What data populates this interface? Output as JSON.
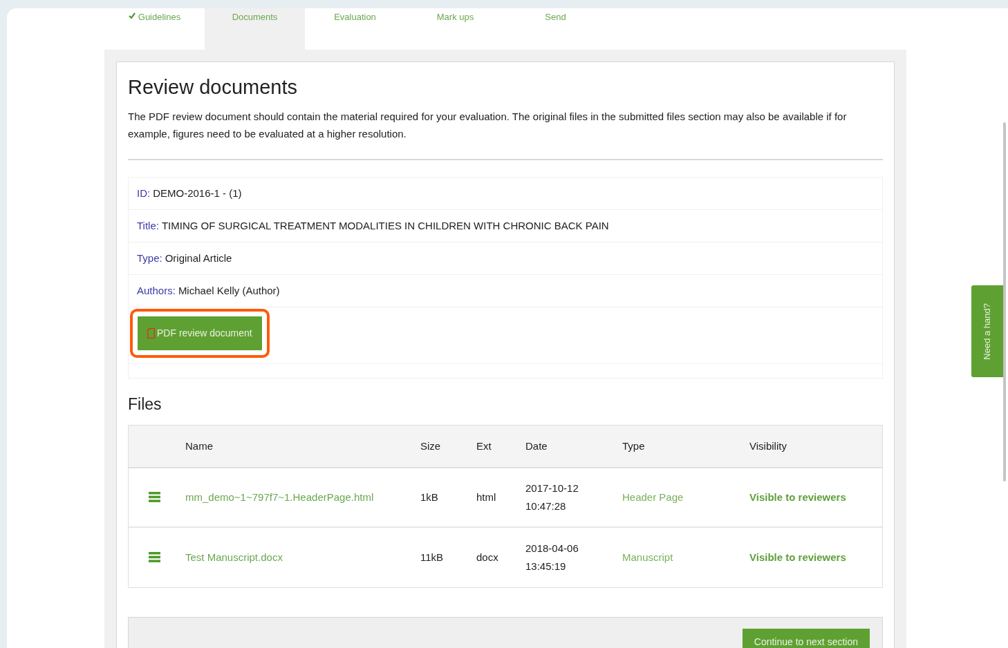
{
  "tabs": [
    {
      "label": "Guidelines",
      "completed": true,
      "selected": false
    },
    {
      "label": "Documents",
      "completed": false,
      "selected": true
    },
    {
      "label": "Evaluation",
      "completed": false,
      "selected": false
    },
    {
      "label": "Mark ups",
      "completed": false,
      "selected": false
    },
    {
      "label": "Send",
      "completed": false,
      "selected": false
    }
  ],
  "heading": "Review documents",
  "intro": "The PDF review document should contain the material required for your evaluation. The original files in the submitted files section may also be available if for example, figures need to be evaluated at a higher resolution.",
  "details": [
    {
      "label": "ID:",
      "value": "DEMO-2016-1 - (1)"
    },
    {
      "label": "Title:",
      "value": "TIMING OF SURGICAL TREATMENT MODALITIES IN CHILDREN WITH CHRONIC BACK PAIN"
    },
    {
      "label": "Type:",
      "value": "Original Article"
    },
    {
      "label": "Authors:",
      "value": "Michael Kelly (Author)"
    }
  ],
  "pdf_button": {
    "label": "PDF review document",
    "highlighted": true
  },
  "files": {
    "title": "Files",
    "columns": [
      "Name",
      "Size",
      "Ext",
      "Date",
      "Type",
      "Visibility"
    ],
    "rows": [
      {
        "name": "mm_demo~1~797f7~1.HeaderPage.html",
        "size": "1kB",
        "ext": "html",
        "date": "2017-10-12",
        "time": "10:47:28",
        "type": "Header Page",
        "visibility": "Visible to reviewers"
      },
      {
        "name": "Test Manuscript.docx",
        "size": "11kB",
        "ext": "docx",
        "date": "2018-04-06",
        "time": "13:45:19",
        "type": "Manuscript",
        "visibility": "Visible to reviewers"
      }
    ]
  },
  "continue_button": "Continue to next section",
  "help_tab": "Need a hand?"
}
